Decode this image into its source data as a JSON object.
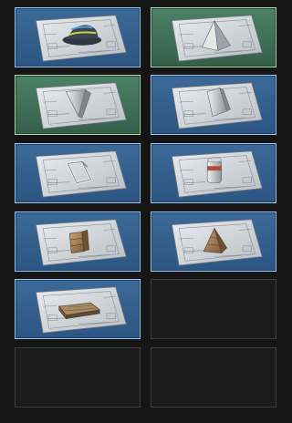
{
  "slots": [
    {
      "state": "filled",
      "highlight": "blue",
      "item": "hat-blueprint"
    },
    {
      "state": "filled",
      "highlight": "green",
      "item": "pyramid-blueprint"
    },
    {
      "state": "filled",
      "highlight": "green",
      "item": "wedge-blueprint"
    },
    {
      "state": "filled",
      "highlight": "blue",
      "item": "ramp-blueprint"
    },
    {
      "state": "filled",
      "highlight": "blue",
      "item": "frame-blueprint"
    },
    {
      "state": "filled",
      "highlight": "blue",
      "item": "barrel-blueprint"
    },
    {
      "state": "filled",
      "highlight": "blue",
      "item": "crate-blueprint"
    },
    {
      "state": "filled",
      "highlight": "blue",
      "item": "stair-block-blueprint"
    },
    {
      "state": "filled",
      "highlight": "blue",
      "item": "floor-slab-blueprint"
    },
    {
      "state": "empty"
    },
    {
      "state": "empty"
    },
    {
      "state": "empty"
    }
  ],
  "colors": {
    "blue_border": "#9ec6ea",
    "blue_fill": "#3c6a98",
    "green_border": "#b2dcae",
    "green_fill": "#4c8267",
    "empty_border": "#3d3d3d",
    "background": "#151515"
  }
}
